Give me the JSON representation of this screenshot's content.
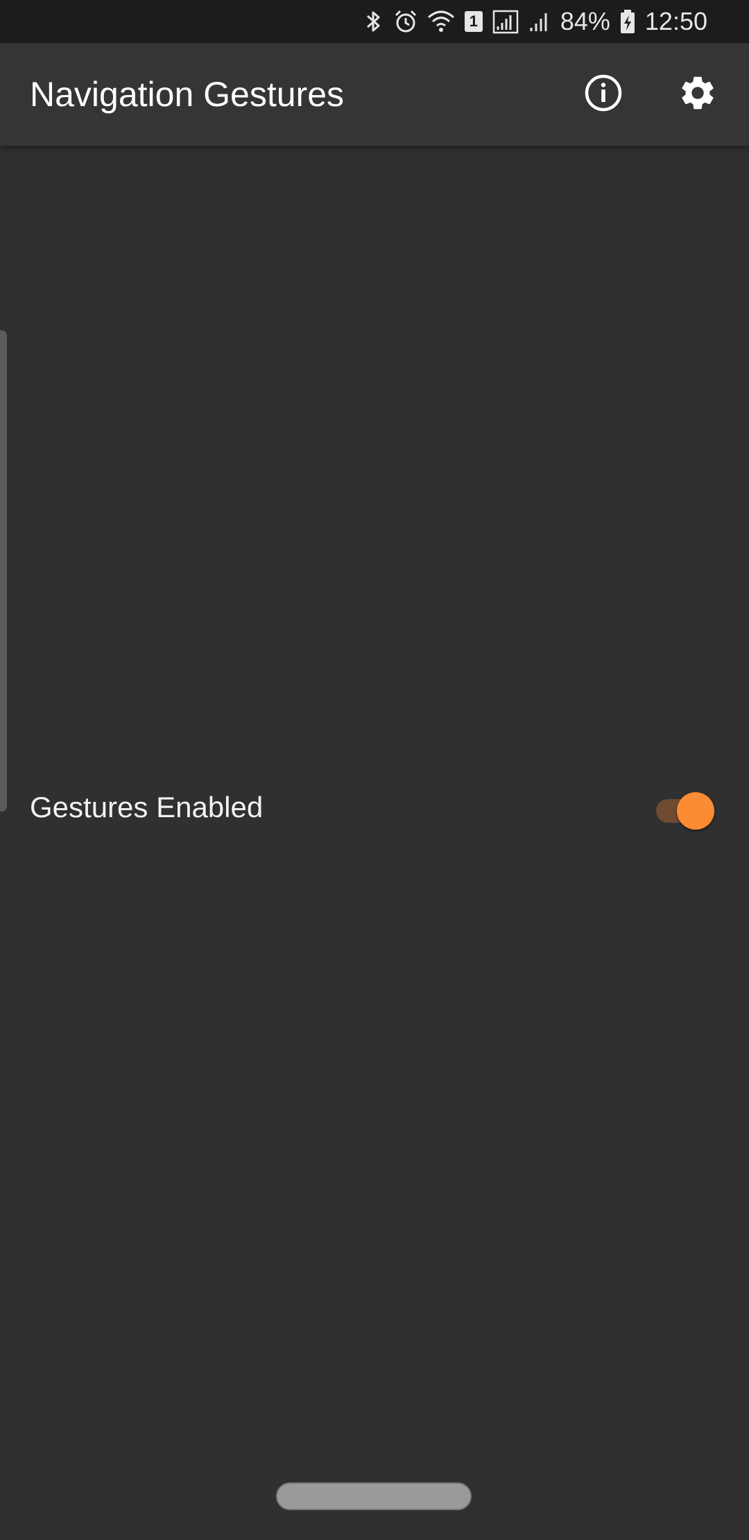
{
  "status_bar": {
    "battery_percent": "84%",
    "time": "12:50",
    "sim_slot": "1",
    "icons": [
      "bluetooth-icon",
      "alarm-icon",
      "wifi-icon",
      "sim-icon",
      "signal-icon",
      "signal-weak-icon",
      "battery-charging-icon"
    ]
  },
  "app_bar": {
    "title": "Navigation Gestures",
    "actions": [
      "info-icon",
      "settings-icon"
    ]
  },
  "settings": {
    "gestures_label": "Gestures Enabled",
    "gestures_enabled": true
  },
  "colors": {
    "background": "#303030",
    "app_bar": "#353535",
    "status_bar": "#1c1c1c",
    "accent": "#fb8c33",
    "toggle_track": "#6f4b32",
    "home_pill": "#9a9a9a"
  }
}
